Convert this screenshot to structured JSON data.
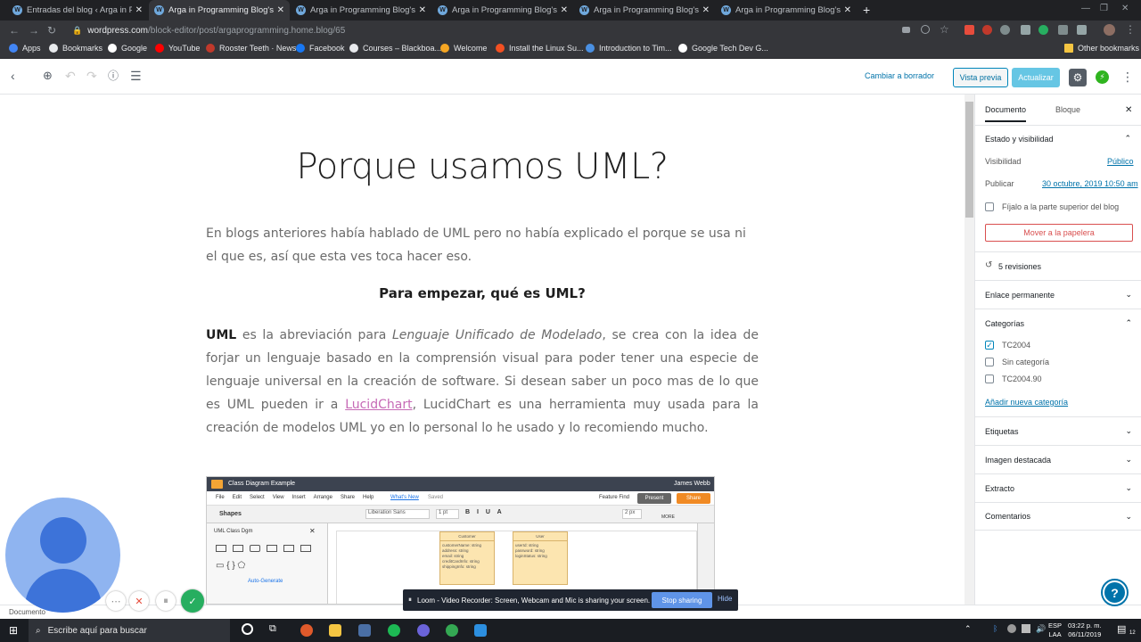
{
  "browser": {
    "tabs": [
      {
        "title": "Entradas del blog ‹ Arga in Programming",
        "close": "✕",
        "active": false
      },
      {
        "title": "Arga in Programming Blog's — WordPress",
        "close": "✕",
        "active": true
      },
      {
        "title": "Arga in Programming Blog's — WordPress",
        "close": "✕",
        "active": false
      },
      {
        "title": "Arga in Programming Blog's — WordPress",
        "close": "✕",
        "active": false
      },
      {
        "title": "Arga in Programming Blog's — WordPress",
        "close": "✕",
        "active": false
      },
      {
        "title": "Arga in Programming Blog's — WordPress",
        "close": "✕",
        "active": false
      }
    ],
    "new_tab": "+",
    "url_domain": "wordpress.com",
    "url_path": "/block-editor/post/argaprogramming.home.blog/65",
    "bookmarks": [
      {
        "label": "Apps",
        "color": "#4285f4"
      },
      {
        "label": "Bookmarks",
        "color": "#e8eaed"
      },
      {
        "label": "Google",
        "color": "#ffffff"
      },
      {
        "label": "YouTube",
        "color": "#ff0000"
      },
      {
        "label": "Rooster Teeth · News",
        "color": "#c0392b"
      },
      {
        "label": "Facebook",
        "color": "#1877f2"
      },
      {
        "label": "Courses – Blackboa...",
        "color": "#e8eaed"
      },
      {
        "label": "Welcome",
        "color": "#f5a623"
      },
      {
        "label": "Install the Linux Su...",
        "color": "#f25022"
      },
      {
        "label": "Introduction to Tim...",
        "color": "#4a90e2"
      },
      {
        "label": "Google Tech Dev G...",
        "color": "#ffffff"
      }
    ],
    "other_bookmarks": "Other bookmarks"
  },
  "toolbar": {
    "draft_label": "Cambiar a borrador",
    "preview_label": "Vista previa",
    "update_label": "Actualizar"
  },
  "post": {
    "title": "Porque usamos UML?",
    "intro": "En blogs anteriores había hablado de UML pero no había explicado el porque se usa ni el que es, así que esta ves toca hacer eso.",
    "subheading": "Para empezar, qué es UML?",
    "p2_bold": "UML",
    "p2_a": " es la abreviación para ",
    "p2_italic": "Lenguaje Unificado de Modelado",
    "p2_b": ", se crea con la idea de forjar un lenguaje basado en la comprensión visual para poder tener una especie de lenguaje universal en la creación de software. Si desean saber un poco mas de lo que es UML pueden ir a ",
    "p2_link": "LucidChart",
    "p2_c": ", LucidChart es una herramienta muy usada para la creación de modelos UML yo en lo personal lo he usado y lo recomiendo mucho."
  },
  "embedded": {
    "doc_title": "Class Diagram Example",
    "user": "James Webb",
    "menu": [
      "File",
      "Edit",
      "Select",
      "View",
      "Insert",
      "Arrange",
      "Share",
      "Help"
    ],
    "whats_new": "What's New",
    "saved": "Saved",
    "feature_find": "Feature Find",
    "present": "Present",
    "share": "Share",
    "shapes": "Shapes",
    "font": "Liberation Sans",
    "pt": "1 pt",
    "px": "2 px",
    "more": "MORE",
    "lib": "UML Class Dgm",
    "autogen": "Auto-Generate",
    "class1_name": "Customer",
    "class1_fields": "customerName: string\naddress: string\nemail: string\ncreditCardInfo: string\nshippingInfo: string",
    "class2_name": "User",
    "class2_fields": "userId: string\npassword: string\nloginStatus: string"
  },
  "sidebar": {
    "tab_document": "Documento",
    "tab_block": "Bloque",
    "section_status": "Estado y visibilidad",
    "visibility_label": "Visibilidad",
    "visibility_value": "Público",
    "publish_label": "Publicar",
    "publish_value": "30 octubre, 2019 10:50 am",
    "sticky_label": "Fíjalo a la parte superior del blog",
    "trash_label": "Mover a la papelera",
    "revisions": "5 revisiones",
    "permalink": "Enlace permanente",
    "categories": "Categorías",
    "category_items": [
      {
        "label": "TC2004",
        "checked": true
      },
      {
        "label": "Sin categoría",
        "checked": false
      },
      {
        "label": "TC2004.90",
        "checked": false
      }
    ],
    "add_category": "Añadir nueva categoría",
    "tags": "Etiquetas",
    "featured": "Imagen destacada",
    "excerpt": "Extracto",
    "comments": "Comentarios"
  },
  "status": {
    "crumb": "Documento"
  },
  "loom": {
    "message": "Loom - Video Recorder: Screen, Webcam and Mic is sharing your screen.",
    "stop": "Stop sharing",
    "hide": "Hide"
  },
  "taskbar": {
    "search_placeholder": "Escribe aquí para buscar",
    "lang1": "ESP",
    "lang2": "LAA",
    "time": "03:22 p. m.",
    "date": "06/11/2019",
    "notif": "12"
  }
}
